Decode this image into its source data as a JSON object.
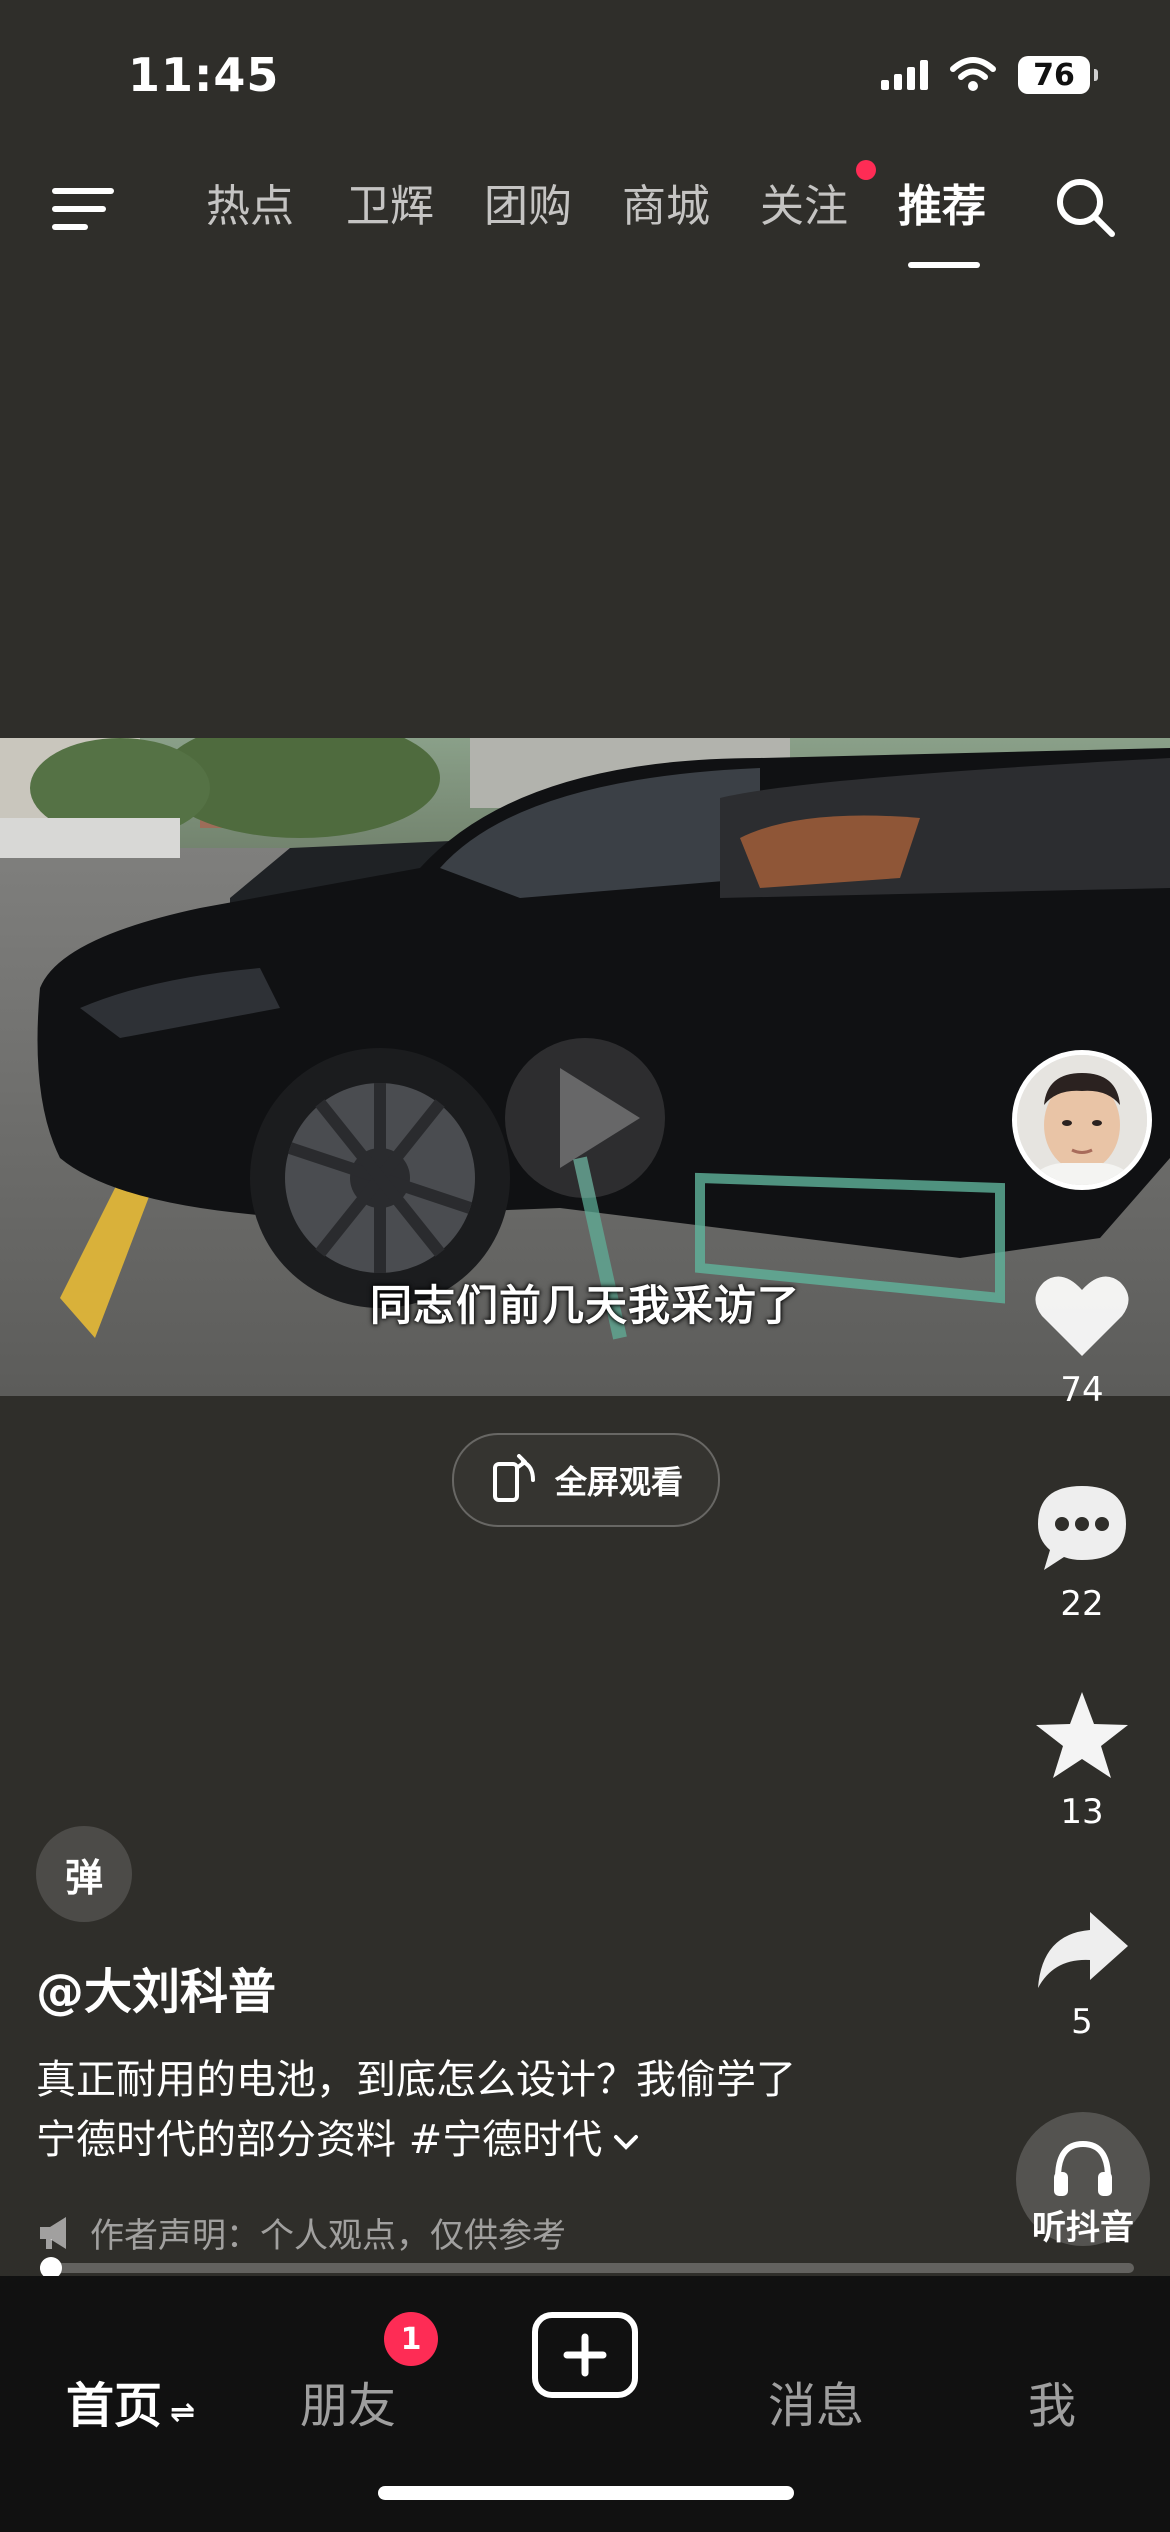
{
  "status_bar": {
    "time": "11:45",
    "battery": "76"
  },
  "top_nav": {
    "cut_tab": "",
    "tabs": [
      "热点",
      "卫辉",
      "团购",
      "商城",
      "关注",
      "推荐"
    ],
    "active_tab": "推荐"
  },
  "video": {
    "subtitle": "同志们前几天我采访了",
    "fullscreen_label": "全屏观看"
  },
  "actions": {
    "likes": "74",
    "comments": "22",
    "favorites": "13",
    "shares": "5",
    "listen_label": "听抖音"
  },
  "post": {
    "danmu_label": "弹",
    "author": "@大刘科普",
    "description_line1": "真正耐用的电池，到底怎么设计？我偷学了",
    "description_line2": "宁德时代的部分资料 #宁德时代",
    "disclaimer": "作者声明：个人观点，仅供参考",
    "progress": 0.01
  },
  "bottom_tabs": {
    "home": "首页",
    "home_suffix": "⇌",
    "friends": "朋友",
    "friends_badge": "1",
    "messages": "消息",
    "me": "我"
  },
  "colors": {
    "accent": "#fe2c55",
    "background": "#2f2e2a",
    "tabbar": "#111111"
  }
}
